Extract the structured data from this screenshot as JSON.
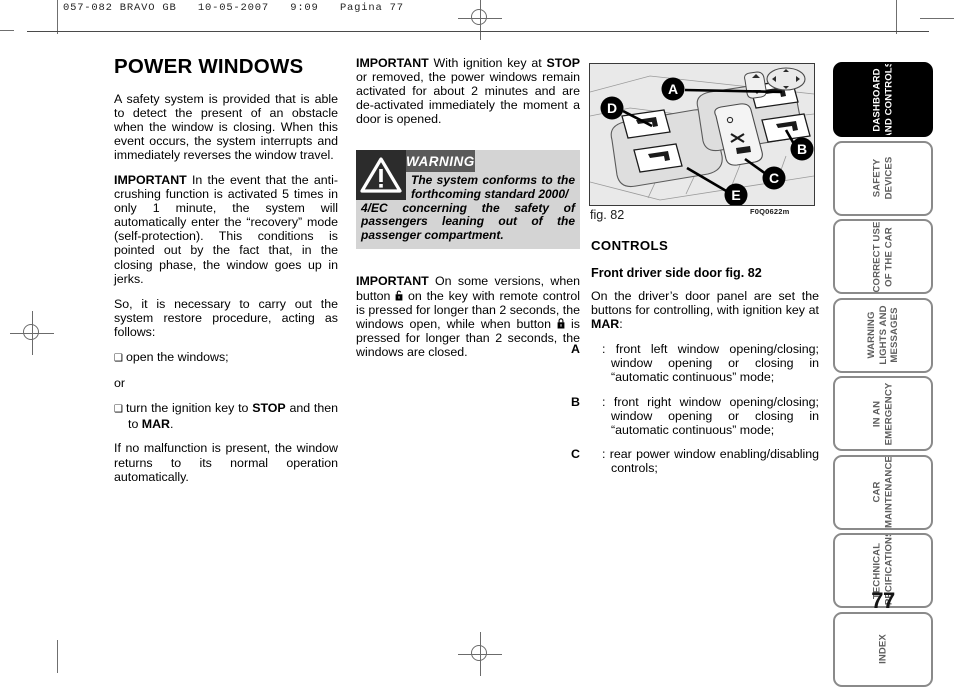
{
  "header": {
    "stamp": "057-082 BRAVO GB   10-05-2007   9:09   Pagina 77"
  },
  "page_number": "77",
  "col1": {
    "title": "POWER WINDOWS",
    "p1": "A safety system is provided that is able to detect the present of an obstacle when the window is closing.  When this event occurs, the system interrupts and immediately reverses the window travel.",
    "p2_lead": "IMPORTANT",
    "p2": " In the event that the anti-crushing function is activated 5 times in only 1 minute, the system will automatically enter the “recovery” mode (self-protection). This conditions is pointed out by the fact that, in the closing phase, the window goes up in jerks.",
    "p3": "So, it is necessary to carry out the system restore procedure, acting as follows:",
    "bullet1": "open the windows;",
    "or_text": "or",
    "bullet2_a": "turn the ignition key to ",
    "bullet2_stop": "STOP",
    "bullet2_b": " and then to ",
    "bullet2_mar": "MAR",
    "bullet2_c": ".",
    "p4": "If no malfunction is present, the window returns to its normal operation automatically."
  },
  "col2": {
    "p1_lead": "IMPORTANT",
    "p1_a": " With ignition key at ",
    "p1_stop": "STOP",
    "p1_b": " or removed, the power windows remain activated for about 2 minutes and are de-activated immediately the moment a door is opened.",
    "warning": {
      "title": "WARNING",
      "text": "The system conforms to the forthcoming standard 2000/4/EC concerning the safety of passengers leaning out of the passenger compartment.",
      "icon": "warning-triangle-icon"
    },
    "p2_lead": "IMPORTANT",
    "p2_a": " On some versions, when button ",
    "p2_icon1": "padlock-open-icon",
    "p2_b": " on the key with remote control is pressed for longer than 2 seconds, the windows open, while when button ",
    "p2_icon2": "padlock-closed-icon",
    "p2_c": " is pressed for longer than 2 seconds, the windows are closed."
  },
  "col3": {
    "figure": {
      "caption": "fig. 82",
      "code": "F0Q0622m",
      "callouts": [
        "A",
        "B",
        "C",
        "D",
        "E"
      ],
      "alt": "driver door panel power window switch cluster"
    },
    "section_title": "CONTROLS",
    "subsection_title": "Front driver side door fig. 82",
    "intro_a": "On the driver’s door panel are set the buttons for controlling, with ignition key at ",
    "intro_mar": "MAR",
    "intro_b": ":",
    "items": [
      {
        "label": "A",
        "text": "front left window opening/closing; window opening or closing in “automatic continuous” mode;"
      },
      {
        "label": "B",
        "text": "front right window opening/closing; window opening or closing in “automatic continuous” mode;"
      },
      {
        "label": "C",
        "text": "rear power window enabling/disabling controls;"
      }
    ]
  },
  "tabs": [
    {
      "label": "DASHBOARD\nAND CONTROLS",
      "active": true
    },
    {
      "label": "SAFETY\nDEVICES",
      "active": false
    },
    {
      "label": "CORRECT USE\nOF THE CAR",
      "active": false
    },
    {
      "label": "WARNING\nLIGHTS AND\nMESSAGES",
      "active": false
    },
    {
      "label": "IN AN\nEMERGENCY",
      "active": false
    },
    {
      "label": "CAR\nMAINTENANCE",
      "active": false
    },
    {
      "label": "TECHNICAL\nSPECIFICATIONS",
      "active": false
    },
    {
      "label": "INDEX",
      "active": false
    }
  ],
  "colors": {
    "warning_bar": "#5a5a5a",
    "warning_body": "#d4d4d4",
    "tab_border": "#8a8a8a",
    "tab_active_bg": "#000000",
    "figure_bg": "#e9e9e9"
  }
}
